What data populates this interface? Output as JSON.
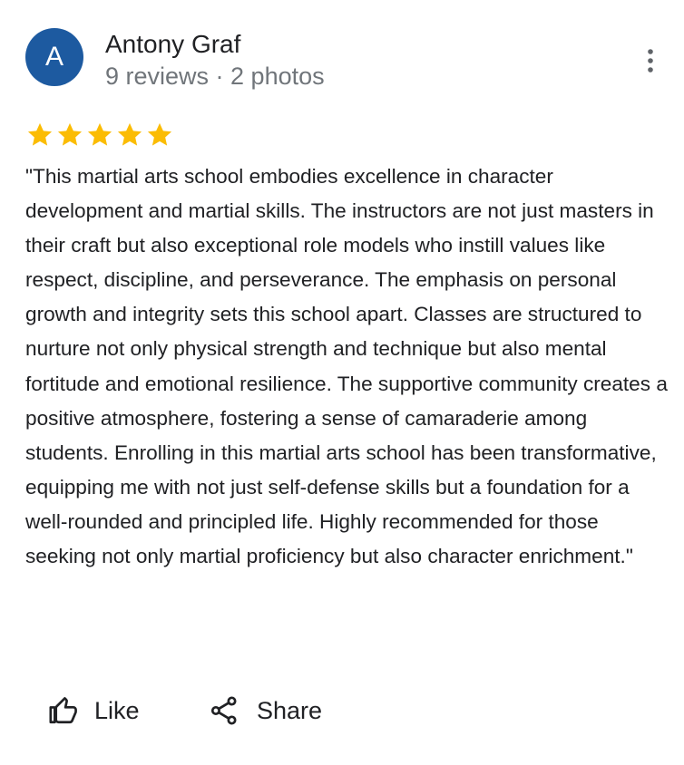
{
  "author": {
    "avatar_letter": "A",
    "avatar_color": "#1d5aa0",
    "name": "Antony Graf",
    "meta": "9 reviews · 2 photos"
  },
  "menu": {
    "icon": "more-vert-icon"
  },
  "rating": {
    "stars": 5,
    "max_stars": 5,
    "star_color": "#fbbc04"
  },
  "review": {
    "text": "\"This martial arts school embodies excellence in character development and martial skills. The instructors are not just masters in their craft but also exceptional role models who instill values like respect, discipline, and perseverance. The emphasis on personal growth and integrity sets this school apart. Classes are structured to nurture not only physical strength and technique but also mental fortitude and emotional resilience. The supportive community creates a positive atmosphere, fostering a sense of camaraderie among students. Enrolling in this martial arts school has been transformative, equipping me with not just self-defense skills but a foundation for a well-rounded and principled life. Highly recommended for those seeking not only martial proficiency but also character enrichment.\""
  },
  "actions": {
    "like_label": "Like",
    "like_icon": "thumbs-up-icon",
    "share_label": "Share",
    "share_icon": "share-icon"
  }
}
